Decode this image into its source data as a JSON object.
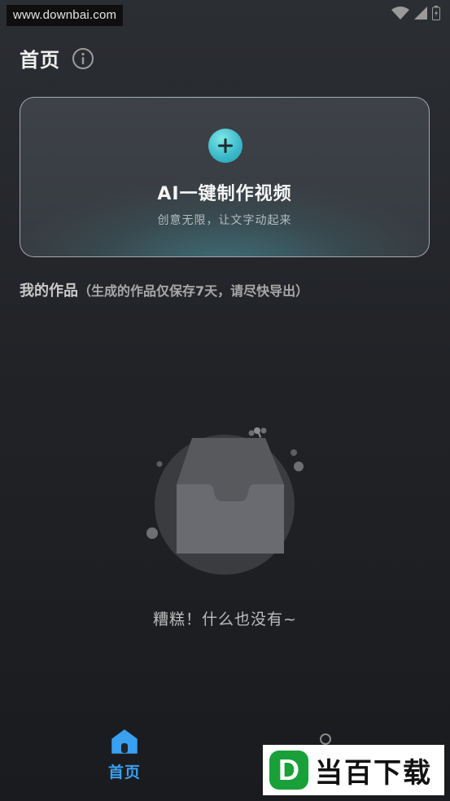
{
  "watermark": {
    "url_text": "www.downbai.com",
    "logo_text": "当百下载",
    "logo_badge": "D"
  },
  "status_bar": {
    "icons": [
      "wifi-icon",
      "signal-icon",
      "battery-icon"
    ]
  },
  "header": {
    "title": "首页",
    "info_icon": "info-icon"
  },
  "create_card": {
    "icon": "plus-icon",
    "title": "AI一键制作视频",
    "subtitle": "创意无限，让文字动起来",
    "accent_color": "#39b8c8"
  },
  "works": {
    "title": "我的作品",
    "note": "（生成的作品仅保存7天，请尽快导出）"
  },
  "empty_state": {
    "icon": "empty-box-icon",
    "text": "糟糕！什么也没有~"
  },
  "tabbar": {
    "tabs": [
      {
        "label": "首页",
        "icon": "home-icon",
        "active": true,
        "color": "#3aa0f0"
      }
    ]
  }
}
